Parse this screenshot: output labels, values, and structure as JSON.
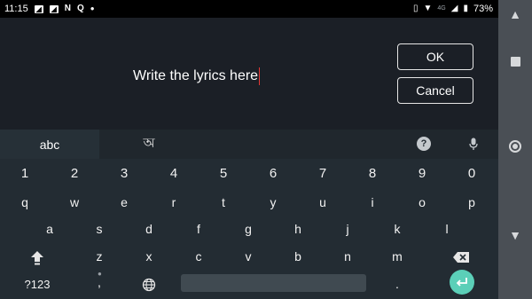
{
  "status_bar": {
    "time": "11:15",
    "left_icons": [
      "photo-icon",
      "photo-icon",
      "n-icon",
      "q-icon",
      "dot-icon"
    ],
    "network": "4G",
    "battery": "73%"
  },
  "dialog": {
    "input_text": "Write the lyrics here",
    "ok_label": "OK",
    "cancel_label": "Cancel"
  },
  "keyboard": {
    "tabs": [
      {
        "label": "abc"
      },
      {
        "label": "অ"
      }
    ],
    "digits": [
      "1",
      "2",
      "3",
      "4",
      "5",
      "6",
      "7",
      "8",
      "9",
      "0"
    ],
    "row_q": [
      "q",
      "w",
      "e",
      "r",
      "t",
      "y",
      "u",
      "i",
      "o",
      "p"
    ],
    "row_a": [
      "a",
      "s",
      "d",
      "f",
      "g",
      "h",
      "j",
      "k",
      "l"
    ],
    "row_z": [
      "z",
      "x",
      "c",
      "v",
      "b",
      "n",
      "m"
    ],
    "bottom": {
      "symbols_label": "?123",
      "comma_label": ",",
      "period_label": "."
    }
  },
  "colors": {
    "accent": "#5bcfb8",
    "caret": "#e53935",
    "background": "#1b1f26"
  }
}
